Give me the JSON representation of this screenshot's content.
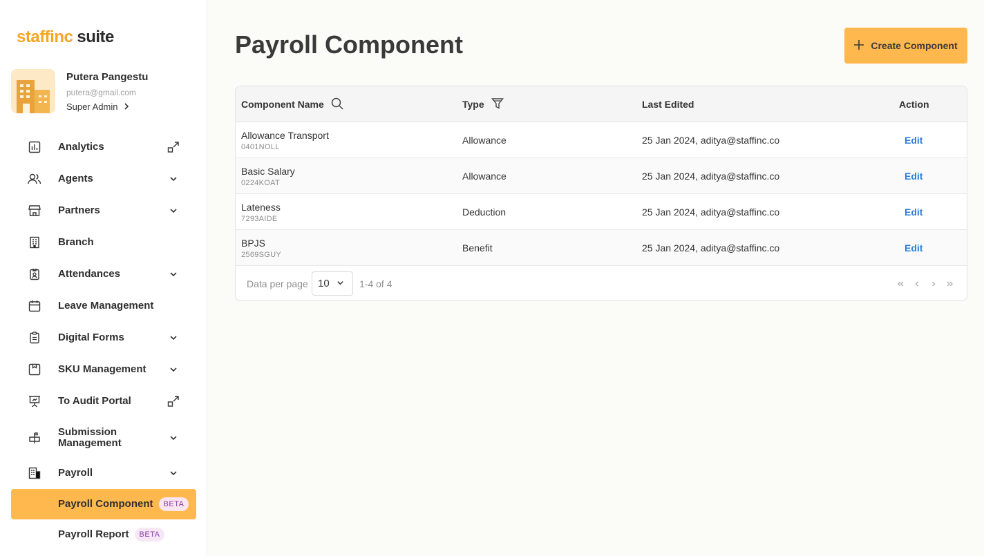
{
  "brand": {
    "part1": "staffinc",
    "part2": "suite",
    "accent": "#f5a623"
  },
  "profile": {
    "name": "Putera Pangestu",
    "email": "putera@gmail.com",
    "role": "Super Admin"
  },
  "sidebar": {
    "items": [
      {
        "label": "Analytics",
        "icon": "chart-icon",
        "trail": "external-link-icon"
      },
      {
        "label": "Agents",
        "icon": "users-icon",
        "trail": "chevron-down-icon"
      },
      {
        "label": "Partners",
        "icon": "store-icon",
        "trail": "chevron-down-icon"
      },
      {
        "label": "Branch",
        "icon": "building-icon",
        "trail": ""
      },
      {
        "label": "Attendances",
        "icon": "badge-icon",
        "trail": "chevron-down-icon"
      },
      {
        "label": "Leave Management",
        "icon": "calendar-icon",
        "trail": ""
      },
      {
        "label": "Digital Forms",
        "icon": "clipboard-icon",
        "trail": "chevron-down-icon"
      },
      {
        "label": "SKU Management",
        "icon": "box-icon",
        "trail": "chevron-down-icon"
      },
      {
        "label": "To Audit Portal",
        "icon": "presentation-icon",
        "trail": "external-link-icon"
      },
      {
        "label": "Submission Management",
        "icon": "mailbox-icon",
        "trail": "chevron-down-icon"
      },
      {
        "label": "Payroll",
        "icon": "payroll-icon",
        "trail": "chevron-down-icon"
      }
    ],
    "sub_items": [
      {
        "label": "Payroll Component",
        "badge": "BETA",
        "active": true
      },
      {
        "label": "Payroll Report",
        "badge": "BETA",
        "active": false
      }
    ]
  },
  "header": {
    "title": "Payroll Component",
    "create_label": "Create Component"
  },
  "table": {
    "columns": {
      "name": "Component Name",
      "type": "Type",
      "last_edited": "Last Edited",
      "action": "Action"
    },
    "rows": [
      {
        "name": "Allowance Transport",
        "code": "0401NOLL",
        "type": "Allowance",
        "last_edited": "25 Jan 2024, aditya@staffinc.co",
        "action": "Edit"
      },
      {
        "name": "Basic Salary",
        "code": "0224KOAT",
        "type": "Allowance",
        "last_edited": "25 Jan 2024, aditya@staffinc.co",
        "action": "Edit"
      },
      {
        "name": "Lateness",
        "code": "7293AIDE",
        "type": "Deduction",
        "last_edited": "25 Jan 2024, aditya@staffinc.co",
        "action": "Edit"
      },
      {
        "name": "BPJS",
        "code": "2569SGUY",
        "type": "Benefit",
        "last_edited": "25 Jan 2024, aditya@staffinc.co",
        "action": "Edit"
      }
    ]
  },
  "pagination": {
    "per_page_label": "Data per page",
    "per_page_value": "10",
    "range": "1-4 of 4"
  },
  "colors": {
    "primary": "#ffb84d",
    "link": "#2f7fd8",
    "badge_text": "#8a3ea6",
    "badge_bg": "#f6e7f7"
  }
}
